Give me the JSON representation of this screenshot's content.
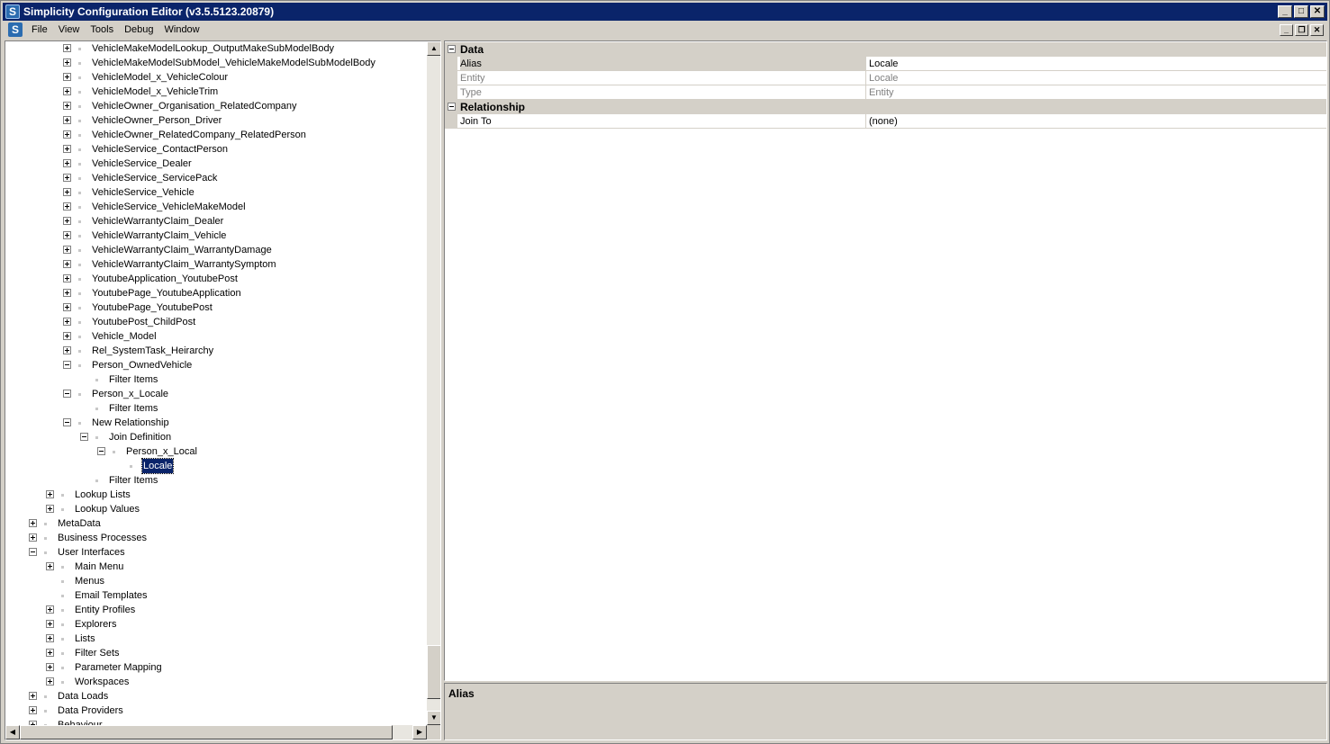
{
  "window": {
    "title": "Simplicity Configuration Editor (v3.5.5123.20879)",
    "app_icon": "S"
  },
  "menu": {
    "items": [
      "File",
      "View",
      "Tools",
      "Debug",
      "Window"
    ]
  },
  "tree": {
    "nodes": [
      {
        "label": "VehicleMakeModelLookup_OutputMakeSubModelBody",
        "level": 3,
        "state": "plus"
      },
      {
        "label": "VehicleMakeModelSubModel_VehicleMakeModelSubModelBody",
        "level": 3,
        "state": "plus"
      },
      {
        "label": "VehicleModel_x_VehicleColour",
        "level": 3,
        "state": "plus"
      },
      {
        "label": "VehicleModel_x_VehicleTrim",
        "level": 3,
        "state": "plus"
      },
      {
        "label": "VehicleOwner_Organisation_RelatedCompany",
        "level": 3,
        "state": "plus"
      },
      {
        "label": "VehicleOwner_Person_Driver",
        "level": 3,
        "state": "plus"
      },
      {
        "label": "VehicleOwner_RelatedCompany_RelatedPerson",
        "level": 3,
        "state": "plus"
      },
      {
        "label": "VehicleService_ContactPerson",
        "level": 3,
        "state": "plus"
      },
      {
        "label": "VehicleService_Dealer",
        "level": 3,
        "state": "plus"
      },
      {
        "label": "VehicleService_ServicePack",
        "level": 3,
        "state": "plus"
      },
      {
        "label": "VehicleService_Vehicle",
        "level": 3,
        "state": "plus"
      },
      {
        "label": "VehicleService_VehicleMakeModel",
        "level": 3,
        "state": "plus"
      },
      {
        "label": "VehicleWarrantyClaim_Dealer",
        "level": 3,
        "state": "plus"
      },
      {
        "label": "VehicleWarrantyClaim_Vehicle",
        "level": 3,
        "state": "plus"
      },
      {
        "label": "VehicleWarrantyClaim_WarrantyDamage",
        "level": 3,
        "state": "plus"
      },
      {
        "label": "VehicleWarrantyClaim_WarrantySymptom",
        "level": 3,
        "state": "plus"
      },
      {
        "label": "YoutubeApplication_YoutubePost",
        "level": 3,
        "state": "plus"
      },
      {
        "label": "YoutubePage_YoutubeApplication",
        "level": 3,
        "state": "plus"
      },
      {
        "label": "YoutubePage_YoutubePost",
        "level": 3,
        "state": "plus"
      },
      {
        "label": "YoutubePost_ChildPost",
        "level": 3,
        "state": "plus"
      },
      {
        "label": "Vehicle_Model",
        "level": 3,
        "state": "plus"
      },
      {
        "label": "Rel_SystemTask_Heirarchy",
        "level": 3,
        "state": "plus"
      },
      {
        "label": "Person_OwnedVehicle",
        "level": 3,
        "state": "minus"
      },
      {
        "label": "Filter Items",
        "level": 4,
        "state": "leaf"
      },
      {
        "label": "Person_x_Locale",
        "level": 3,
        "state": "minus"
      },
      {
        "label": "Filter Items",
        "level": 4,
        "state": "leaf"
      },
      {
        "label": "New Relationship",
        "level": 3,
        "state": "minus"
      },
      {
        "label": "Join Definition",
        "level": 4,
        "state": "minus"
      },
      {
        "label": "Person_x_Local",
        "level": 5,
        "state": "minus"
      },
      {
        "label": "Locale",
        "level": 6,
        "state": "leaf",
        "selected": true
      },
      {
        "label": "Filter Items",
        "level": 4,
        "state": "leaf"
      },
      {
        "label": "Lookup Lists",
        "level": 2,
        "state": "plus"
      },
      {
        "label": "Lookup Values",
        "level": 2,
        "state": "plus"
      },
      {
        "label": "MetaData",
        "level": 1,
        "state": "plus"
      },
      {
        "label": "Business Processes",
        "level": 1,
        "state": "plus"
      },
      {
        "label": "User Interfaces",
        "level": 1,
        "state": "minus"
      },
      {
        "label": "Main Menu",
        "level": 2,
        "state": "plus"
      },
      {
        "label": "Menus",
        "level": 2,
        "state": "leaf"
      },
      {
        "label": "Email Templates",
        "level": 2,
        "state": "leaf"
      },
      {
        "label": "Entity Profiles",
        "level": 2,
        "state": "plus"
      },
      {
        "label": "Explorers",
        "level": 2,
        "state": "plus"
      },
      {
        "label": "Lists",
        "level": 2,
        "state": "plus"
      },
      {
        "label": "Filter Sets",
        "level": 2,
        "state": "plus"
      },
      {
        "label": "Parameter Mapping",
        "level": 2,
        "state": "plus"
      },
      {
        "label": "Workspaces",
        "level": 2,
        "state": "plus"
      },
      {
        "label": "Data Loads",
        "level": 1,
        "state": "plus"
      },
      {
        "label": "Data Providers",
        "level": 1,
        "state": "plus"
      },
      {
        "label": "Behaviour",
        "level": 1,
        "state": "plus"
      }
    ]
  },
  "properties": {
    "categories": [
      {
        "name": "Data",
        "rows": [
          {
            "name": "Alias",
            "value": "Locale",
            "readonly": false,
            "selected": true
          },
          {
            "name": "Entity",
            "value": "Locale",
            "readonly": true
          },
          {
            "name": "Type",
            "value": "Entity",
            "readonly": true
          }
        ]
      },
      {
        "name": "Relationship",
        "rows": [
          {
            "name": "Join To",
            "value": "(none)",
            "readonly": false
          }
        ]
      }
    ]
  },
  "help": {
    "title": "Alias"
  },
  "scroll": {
    "tree_vertical_position": 0.98
  }
}
